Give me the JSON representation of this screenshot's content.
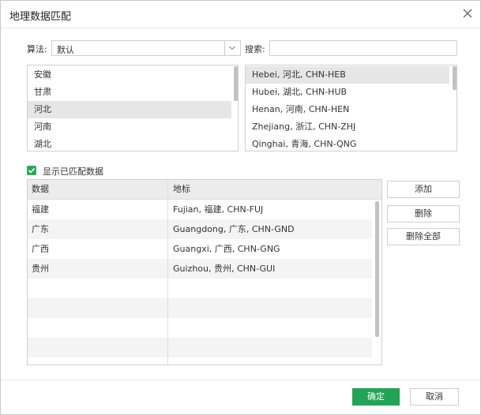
{
  "dialog": {
    "title": "地理数据匹配"
  },
  "algorithm": {
    "label": "算法:",
    "value": "默认"
  },
  "search": {
    "label": "搜索:",
    "value": "",
    "placeholder": ""
  },
  "left_list": {
    "items": [
      "安徽",
      "甘肃",
      "河北",
      "河南",
      "湖北"
    ],
    "selected_index": 2
  },
  "right_list": {
    "items": [
      "Hebei, 河北, CHN-HEB",
      "Hubei, 湖北, CHN-HUB",
      "Henan, 河南, CHN-HEN",
      "Zhejiang, 浙江, CHN-ZHJ",
      "Qinghai, 青海, CHN-QNG"
    ],
    "selected_index": 0
  },
  "show_matched": {
    "label": "显示已匹配数据",
    "checked": true
  },
  "table": {
    "headers": [
      "数据",
      "地标"
    ],
    "rows": [
      [
        "福建",
        "Fujian, 福建, CHN-FUJ"
      ],
      [
        "广东",
        "Guangdong, 广东, CHN-GND"
      ],
      [
        "广西",
        "Guangxi, 广西, CHN-GNG"
      ],
      [
        "贵州",
        "Guizhou, 贵州, CHN-GUI"
      ]
    ]
  },
  "actions": {
    "add": "添加",
    "delete": "删除",
    "delete_all": "删除全部"
  },
  "footer": {
    "ok": "确定",
    "cancel": "取消"
  },
  "colors": {
    "accent": "#20a456",
    "selected_row": "#e6e6e6",
    "scrollbar": "#c2c2c2"
  }
}
